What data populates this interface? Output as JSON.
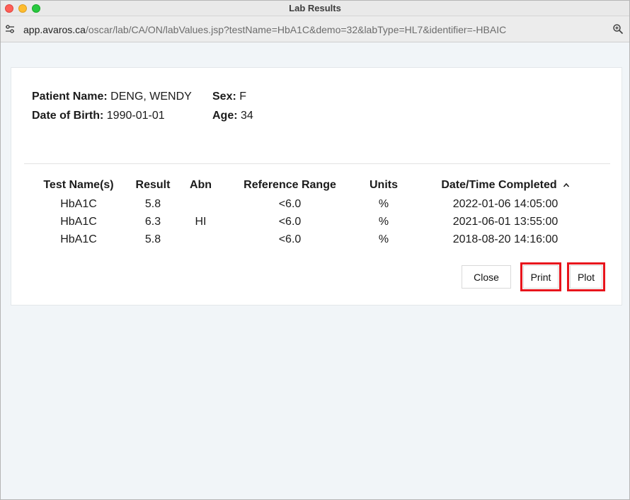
{
  "window": {
    "title": "Lab Results"
  },
  "browser": {
    "url_domain": "app.avaros.ca",
    "url_path": "/oscar/lab/CA/ON/labValues.jsp?testName=HbA1C&demo=32&labType=HL7&identifier=-HBAIC",
    "site_icon": "site-settings-icon",
    "zoom_icon": "zoom-icon"
  },
  "patient": {
    "name_label": "Patient Name:",
    "name": "DENG, WENDY",
    "sex_label": "Sex:",
    "sex": "F",
    "dob_label": "Date of Birth:",
    "dob": "1990-01-01",
    "age_label": "Age:",
    "age": "34"
  },
  "table": {
    "headers": [
      "Test Name(s)",
      "Result",
      "Abn",
      "Reference Range",
      "Units",
      "Date/Time Completed"
    ],
    "sort_indicator": "^",
    "rows": [
      [
        "HbA1C",
        "5.8",
        "",
        "<6.0",
        "%",
        "2022-01-06 14:05:00"
      ],
      [
        "HbA1C",
        "6.3",
        "HI",
        "<6.0",
        "%",
        "2021-06-01 13:55:00"
      ],
      [
        "HbA1C",
        "5.8",
        "",
        "<6.0",
        "%",
        "2018-08-20 14:16:00"
      ]
    ]
  },
  "buttons": {
    "close": "Close",
    "print": "Print",
    "plot": "Plot"
  },
  "colors": {
    "highlight": "#e8141c",
    "background": "#f1f5f8"
  }
}
